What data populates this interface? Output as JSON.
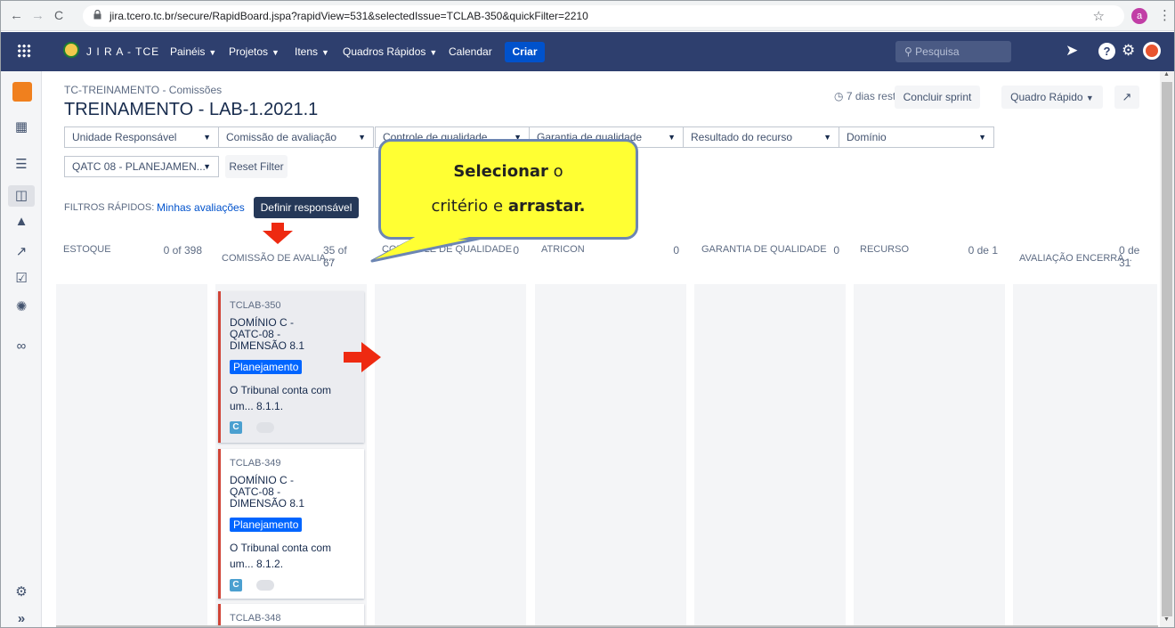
{
  "browser": {
    "back": "←",
    "forward": "→",
    "reload": "C",
    "url": "jira.tcero.tc.br/secure/RapidBoard.jspa?rapidView=531&selectedIssue=TCLAB-350&quickFilter=2210",
    "star": "☆",
    "profile": "a",
    "menu": "⋮"
  },
  "topnav": {
    "brand": "J I R A - TCE",
    "menus": [
      "Painéis",
      "Projetos",
      "Itens",
      "Quadros Rápidos",
      "Calendar"
    ],
    "create": "Criar",
    "search_placeholder": "Pesquisa"
  },
  "header": {
    "breadcrumb": "TC-TREINAMENTO - Comissões",
    "sprint_title": "TREINAMENTO - LAB-1.2021.1",
    "remaining": "7 dias restante(s)",
    "complete_sprint": "Concluir sprint",
    "quick_board": "Quadro Rápido"
  },
  "filters": {
    "row1": [
      "Unidade Responsável",
      "Comissão de avaliação",
      "Controle de qualidade",
      "Garantia de qualidade",
      "Resultado do recurso",
      "Domínio"
    ],
    "row2_select": "QATC 08 - PLANEJAMEN...",
    "reset": "Reset Filter",
    "quick_filters_label": "FILTROS RÁPIDOS:",
    "quick_filter_1": "Minhas avaliações",
    "quick_filter_2": "Definir responsável"
  },
  "columns": [
    {
      "name": "ESTOQUE",
      "count": "0 of 398"
    },
    {
      "name": "COMISSÃO DE AVALIA...",
      "count": "35 of 67"
    },
    {
      "name": "CONTROLE DE QUALIDADE",
      "count": "0"
    },
    {
      "name": "ATRICON",
      "count": "0"
    },
    {
      "name": "GARANTIA DE QUALIDADE",
      "count": "0"
    },
    {
      "name": "RECURSO",
      "count": "0 de 1"
    },
    {
      "name": "AVALIAÇÃO ENCERRA...",
      "count": "0 de 31"
    }
  ],
  "cards": [
    {
      "key": "TCLAB-350",
      "summary": "DOMÍNIO C - QATC-08 - DIMENSÃO 8.1",
      "epic": "Planejamento",
      "description": "O Tribunal conta com um... 8.1.1.",
      "type_letter": "C"
    },
    {
      "key": "TCLAB-349",
      "summary": "DOMÍNIO C - QATC-08 - DIMENSÃO 8.1",
      "epic": "Planejamento",
      "description": "O Tribunal conta com um... 8.1.2.",
      "type_letter": "C"
    },
    {
      "key": "TCLAB-348"
    }
  ],
  "annotation": {
    "line1_bold": "Selecionar",
    "line1_rest": " o",
    "line2_start": "critério e ",
    "line2_bold": "arrastar."
  },
  "colors": {
    "topnav": "#2e3f6e",
    "create_button": "#0052cc",
    "epic_label": "#0065ff",
    "card_flag": "#d04437",
    "callout_fill": "#ffff33",
    "arrow": "#ee2a11"
  }
}
